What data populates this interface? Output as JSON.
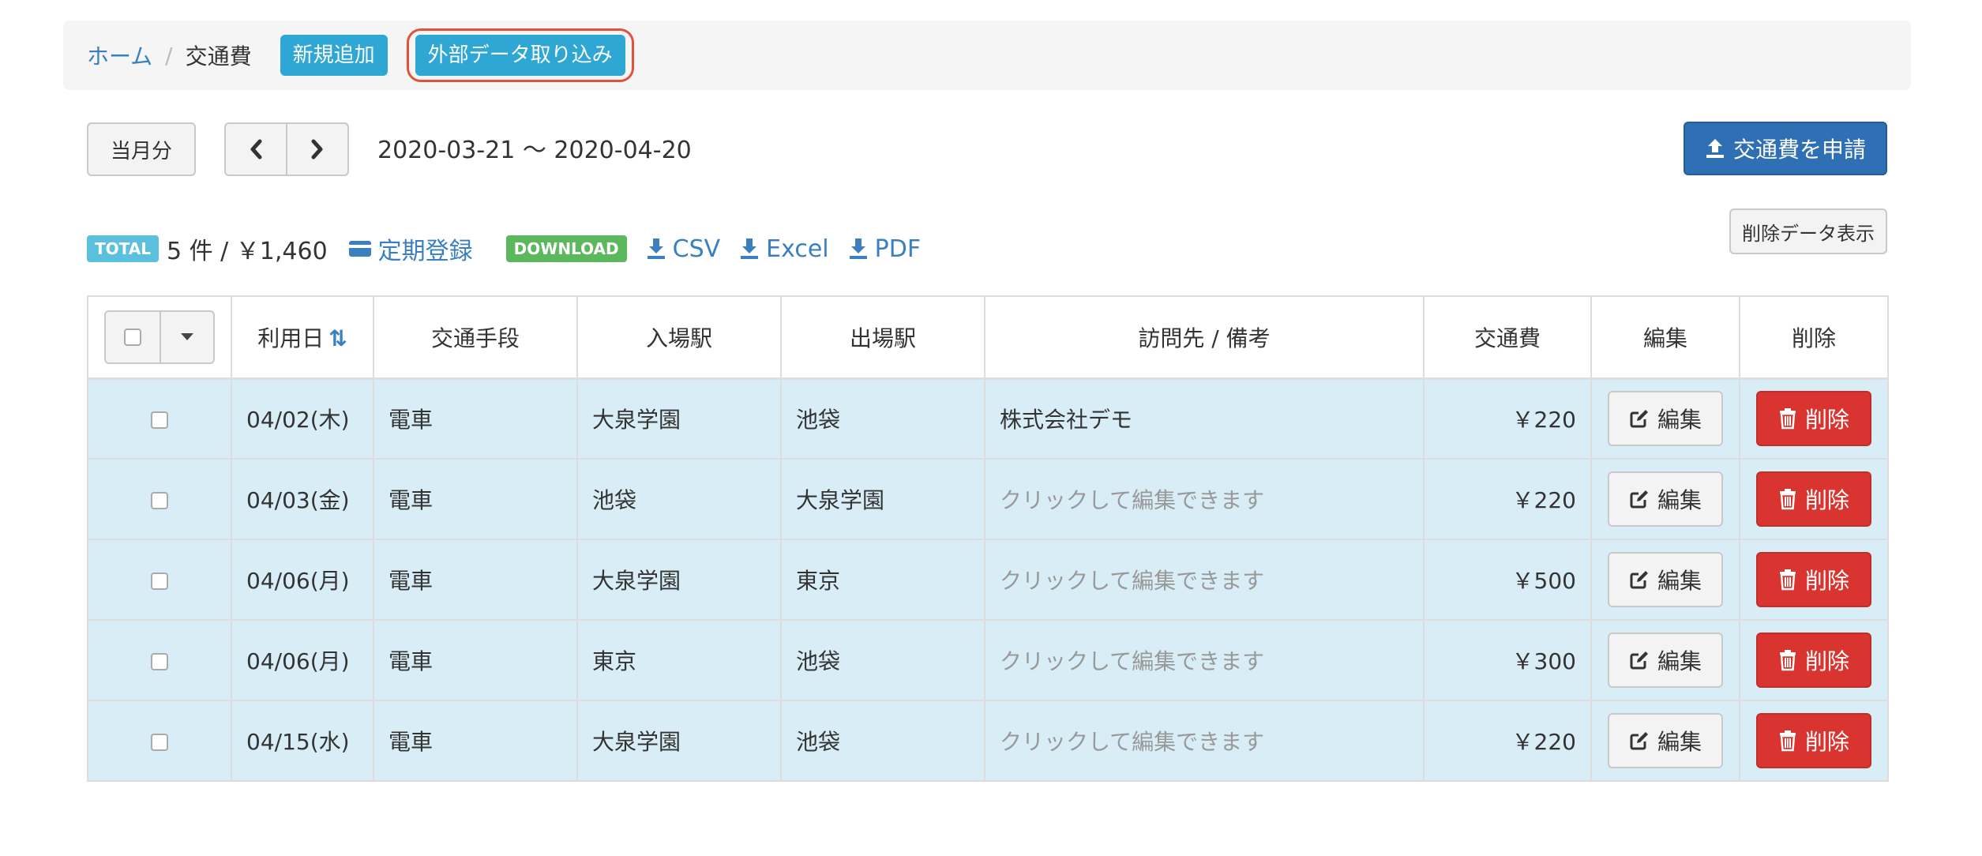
{
  "breadcrumb": {
    "home": "ホーム",
    "separator": "/",
    "current": "交通費",
    "new_button": "新規追加",
    "import_button": "外部データ取り込み"
  },
  "toolbar": {
    "current_month_button": "当月分",
    "date_range": "2020-03-21 〜 2020-04-20",
    "apply_button": "交通費を申請",
    "deleted_data_button": "削除データ表示"
  },
  "summary": {
    "total_badge": "TOTAL",
    "total_text": "5 件 / ￥1,460",
    "teiki_link": "定期登録",
    "download_badge": "DOWNLOAD",
    "csv": "CSV",
    "excel": "Excel",
    "pdf": "PDF"
  },
  "table": {
    "headers": {
      "date": "利用日",
      "mode": "交通手段",
      "entry": "入場駅",
      "exit": "出場駅",
      "note": "訪問先 / 備考",
      "fee": "交通費",
      "edit": "編集",
      "delete": "削除"
    },
    "rows": [
      {
        "date": "04/02(木)",
        "mode": "電車",
        "entry": "大泉学園",
        "exit": "池袋",
        "note": "株式会社デモ",
        "fee": "￥220",
        "edit": "編集",
        "delete": "削除"
      },
      {
        "date": "04/03(金)",
        "mode": "電車",
        "entry": "池袋",
        "exit": "大泉学園",
        "note": "クリックして編集できます",
        "fee": "￥220",
        "edit": "編集",
        "delete": "削除"
      },
      {
        "date": "04/06(月)",
        "mode": "電車",
        "entry": "大泉学園",
        "exit": "東京",
        "note": "クリックして編集できます",
        "fee": "￥500",
        "edit": "編集",
        "delete": "削除"
      },
      {
        "date": "04/06(月)",
        "mode": "電車",
        "entry": "東京",
        "exit": "池袋",
        "note": "クリックして編集できます",
        "fee": "￥300",
        "edit": "編集",
        "delete": "削除"
      },
      {
        "date": "04/15(水)",
        "mode": "電車",
        "entry": "大泉学園",
        "exit": "池袋",
        "note": "クリックして編集できます",
        "fee": "￥220",
        "edit": "編集",
        "delete": "削除"
      }
    ]
  }
}
